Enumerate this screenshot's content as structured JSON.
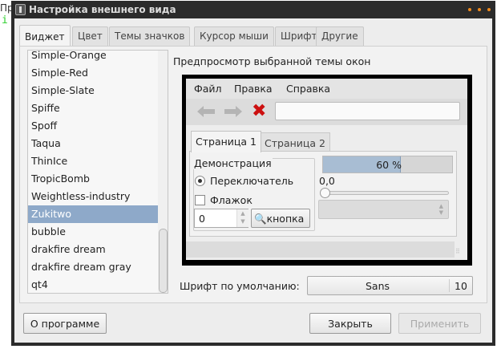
{
  "background": {
    "line1": "Пр",
    "line2": "i"
  },
  "window": {
    "title": "Настройка внешнего вида",
    "accent": "#f08a1c"
  },
  "tabs": [
    {
      "label": "Виджет",
      "active": true
    },
    {
      "label": "Цвет"
    },
    {
      "label": "Темы значков"
    },
    {
      "label": "Курсор мыши"
    },
    {
      "label": "Шрифт"
    },
    {
      "label": "Другие"
    }
  ],
  "themes": [
    "Simple-Orange",
    "Simple-Red",
    "Simple-Slate",
    "Spiffe",
    "Spoff",
    "Taqua",
    "ThinIce",
    "TropicBomb",
    "Weightless-industry",
    "Zukitwo",
    "bubble",
    "drakfire dream",
    "drakfire dream gray",
    "qt4"
  ],
  "selected_theme": "Zukitwo",
  "preview": {
    "label": "Предпросмотр выбранной темы окон",
    "menu": [
      "Файл",
      "Правка",
      "Справка"
    ],
    "tabs": [
      "Страница 1",
      "Страница 2"
    ],
    "group_label": "Демонстрация",
    "radio_label": "Переключатель",
    "check_label": "Флажок",
    "spin_value": "0",
    "button_label": "кнопка",
    "progress_text": "60 %",
    "progress": 60,
    "value_text": "0,0",
    "slider": 0
  },
  "font": {
    "label": "Шрифт по умолчанию:",
    "name": "Sans",
    "size": "10"
  },
  "buttons": {
    "about": "О программе",
    "close": "Закрыть",
    "apply": "Применить"
  }
}
